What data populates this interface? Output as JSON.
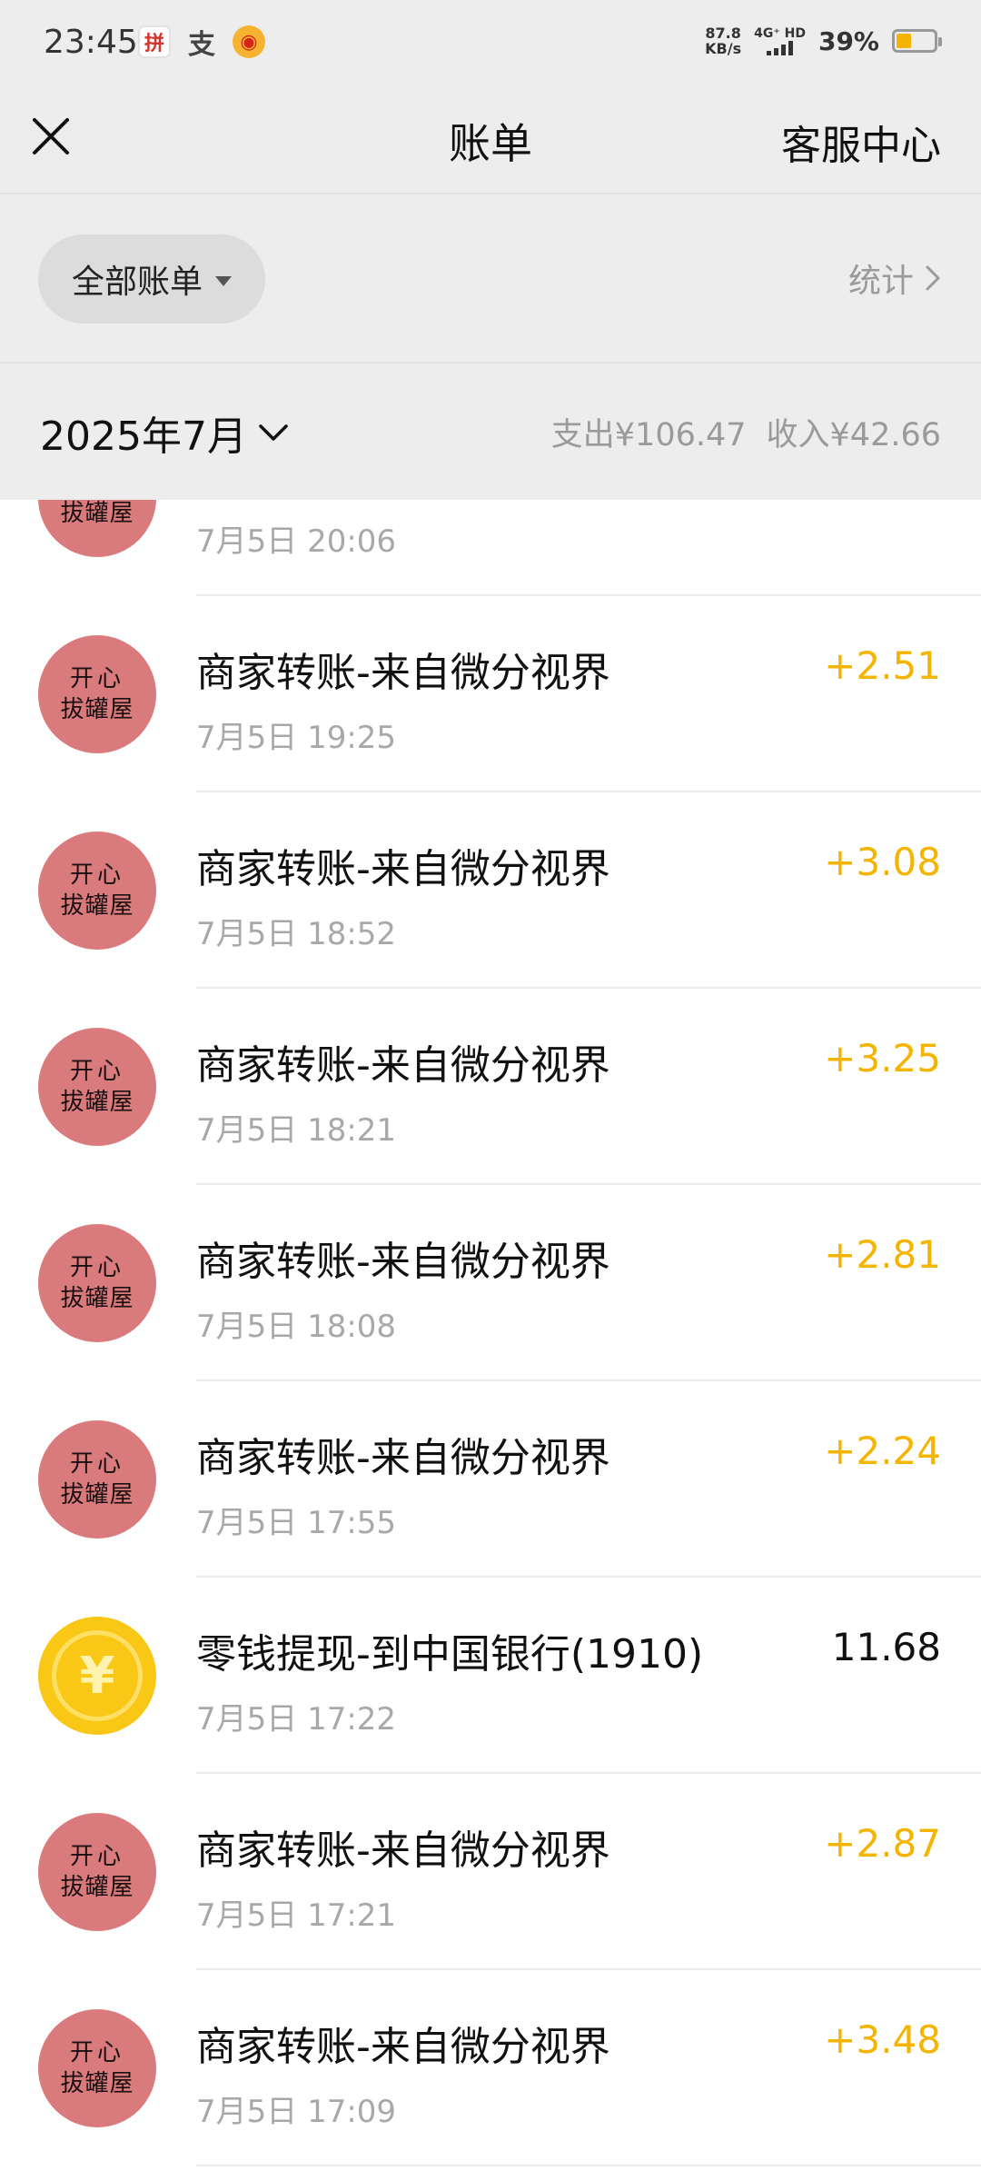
{
  "status_bar": {
    "time": "23:45",
    "app_icons": [
      "pdd-icon",
      "alipay-icon",
      "weibo-icon"
    ],
    "speed_value": "87.8",
    "speed_unit": "KB/s",
    "network_label": "4G⁺ HD",
    "battery_text": "39%",
    "battery_level": 0.39
  },
  "nav": {
    "title": "账单",
    "service_label": "客服中心"
  },
  "filter": {
    "all_bills_label": "全部账单",
    "stats_label": "统计"
  },
  "month_header": {
    "month": "2025年7月",
    "expense_label": "支出",
    "expense_amount": "¥106.47",
    "income_label": "收入",
    "income_amount": "¥42.66"
  },
  "colors": {
    "income": "#f5b400",
    "expense": "#111111",
    "header_bg": "#ededed",
    "shop_avatar": "#d97a7c",
    "coin_avatar": "#f9c816"
  },
  "shop_avatar_text": {
    "line1": "开心",
    "line2": "拔罐屋"
  },
  "coin_symbol": "¥",
  "transactions": [
    {
      "avatar": "shop",
      "title": "",
      "time": "7月5日 20:06",
      "amount": "",
      "type": "income"
    },
    {
      "avatar": "shop",
      "title": "商家转账-来自微分视界",
      "time": "7月5日 19:25",
      "amount": "+2.51",
      "type": "income"
    },
    {
      "avatar": "shop",
      "title": "商家转账-来自微分视界",
      "time": "7月5日 18:52",
      "amount": "+3.08",
      "type": "income"
    },
    {
      "avatar": "shop",
      "title": "商家转账-来自微分视界",
      "time": "7月5日 18:21",
      "amount": "+3.25",
      "type": "income"
    },
    {
      "avatar": "shop",
      "title": "商家转账-来自微分视界",
      "time": "7月5日 18:08",
      "amount": "+2.81",
      "type": "income"
    },
    {
      "avatar": "shop",
      "title": "商家转账-来自微分视界",
      "time": "7月5日 17:55",
      "amount": "+2.24",
      "type": "income"
    },
    {
      "avatar": "coin",
      "title": "零钱提现-到中国银行(1910)",
      "time": "7月5日 17:22",
      "amount": "11.68",
      "type": "expense"
    },
    {
      "avatar": "shop",
      "title": "商家转账-来自微分视界",
      "time": "7月5日 17:21",
      "amount": "+2.87",
      "type": "income"
    },
    {
      "avatar": "shop",
      "title": "商家转账-来自微分视界",
      "time": "7月5日 17:09",
      "amount": "+3.48",
      "type": "income"
    }
  ]
}
